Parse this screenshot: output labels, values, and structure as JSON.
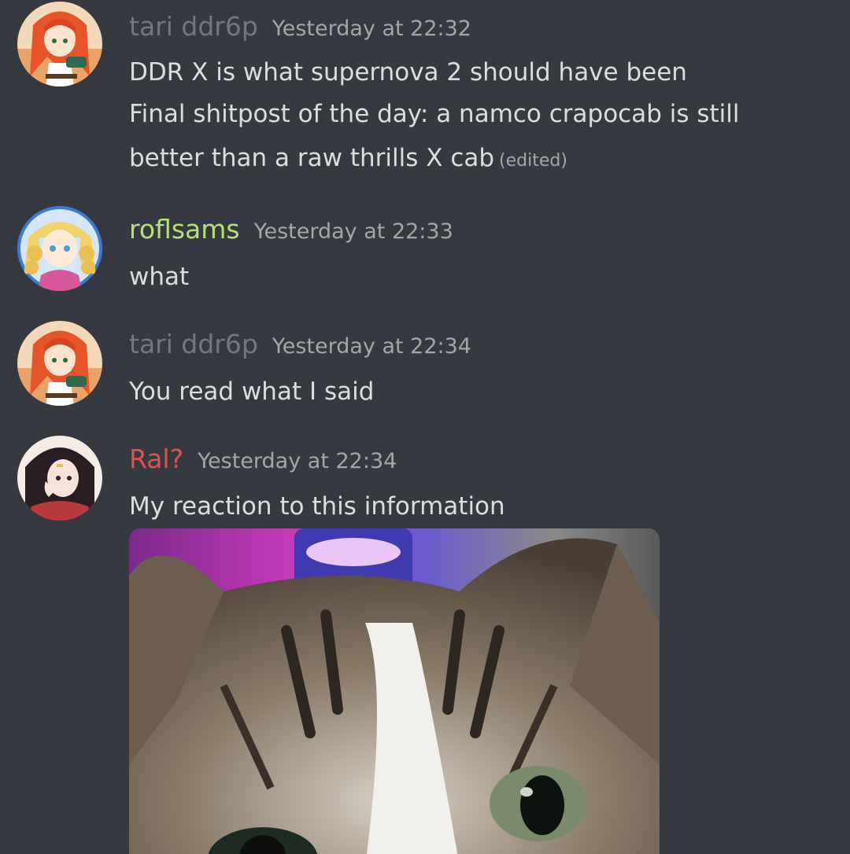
{
  "messages": [
    {
      "author": "tari ddr6p",
      "author_color": "#72767d",
      "timestamp": "Yesterday at 22:32",
      "lines": [
        "DDR X is what supernova 2 should have been",
        "Final shitpost of the day: a namco crapocab is still",
        "better than a raw thrills X cab"
      ],
      "edited_label": "(edited)"
    },
    {
      "author": "roflsams",
      "author_color": "#b5e07a",
      "timestamp": "Yesterday at 22:33",
      "lines": [
        "what"
      ]
    },
    {
      "author": "tari ddr6p",
      "author_color": "#72767d",
      "timestamp": "Yesterday at 22:34",
      "lines": [
        "You read what I said"
      ]
    },
    {
      "author": "Ral?",
      "author_color": "#d9534f",
      "timestamp": "Yesterday at 22:34",
      "lines": [
        "My reaction to this information"
      ],
      "attachment": "cat-closeup-photo"
    }
  ],
  "theme": {
    "background": "#36393f",
    "text": "#dcddde",
    "muted": "#a3a6aa"
  }
}
